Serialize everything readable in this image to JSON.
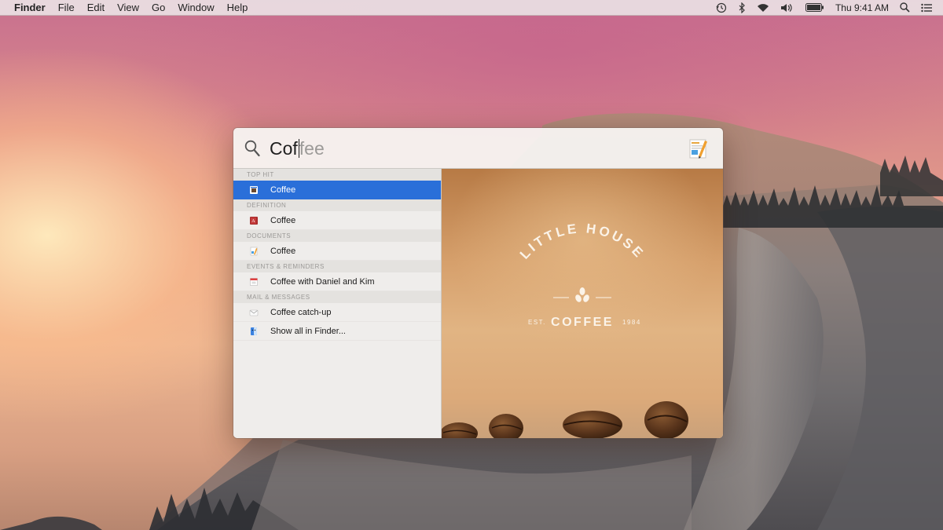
{
  "menubar": {
    "app_name": "Finder",
    "items": [
      "File",
      "Edit",
      "View",
      "Go",
      "Window",
      "Help"
    ],
    "clock": "Thu 9:41 AM",
    "status_icons": [
      "time-machine-icon",
      "bluetooth-icon",
      "wifi-icon",
      "volume-icon",
      "battery-icon",
      "spotlight-icon",
      "notification-center-icon"
    ]
  },
  "spotlight": {
    "query_typed": "Cof",
    "query_completion": "fee",
    "sections": [
      {
        "header": "TOP HIT",
        "rows": [
          {
            "label": "Coffee",
            "icon": "coffee-app-icon",
            "selected": true
          }
        ]
      },
      {
        "header": "DEFINITION",
        "rows": [
          {
            "label": "Coffee",
            "icon": "dictionary-icon",
            "selected": false
          }
        ]
      },
      {
        "header": "DOCUMENTS",
        "rows": [
          {
            "label": "Coffee",
            "icon": "pages-document-icon",
            "selected": false
          }
        ]
      },
      {
        "header": "EVENTS & REMINDERS",
        "rows": [
          {
            "label": "Coffee with Daniel and Kim",
            "icon": "calendar-icon",
            "selected": false
          }
        ]
      },
      {
        "header": "MAIL & MESSAGES",
        "rows": [
          {
            "label": "Coffee catch-up",
            "icon": "mail-icon",
            "selected": false
          }
        ]
      }
    ],
    "show_all": "Show all in Finder...",
    "preview": {
      "logo_top": "LITTLE HOUSE",
      "logo_main": "COFFEE",
      "logo_est_left": "EST.",
      "logo_est_right": "1984"
    }
  },
  "colors": {
    "selection": "#2a6fd9",
    "preview_brown": "#d6a06c"
  }
}
